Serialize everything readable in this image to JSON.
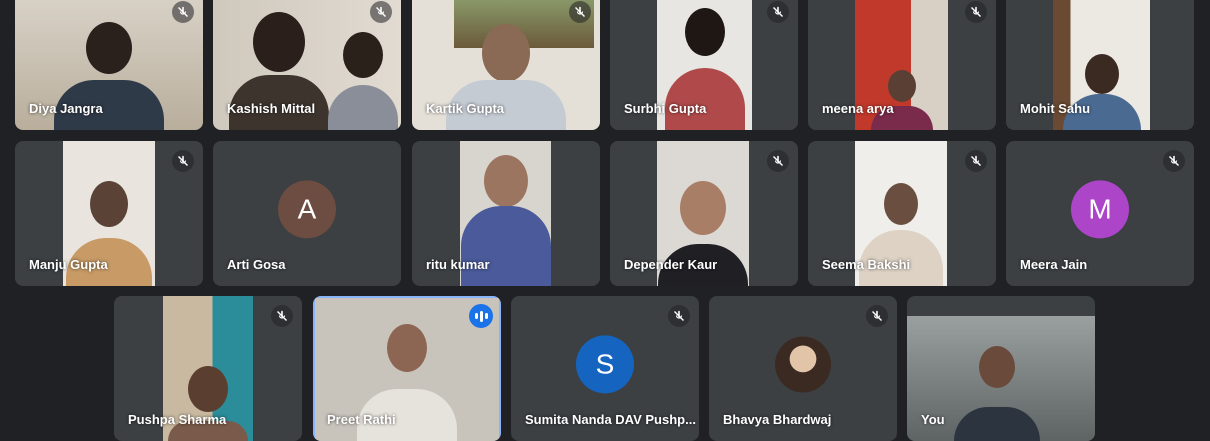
{
  "participants": {
    "diya": "Diya Jangra",
    "kashish": "Kashish Mittal",
    "kartik": "Kartik Gupta",
    "surbhi": "Surbhi Gupta",
    "meena": "meena arya",
    "mohit": "Mohit Sahu",
    "manju": "Manju Gupta",
    "arti": "Arti Gosa",
    "ritu": "ritu kumar",
    "depender": "Depender Kaur",
    "seema": "Seema Bakshi",
    "meera": "Meera Jain",
    "pushpa": "Pushpa Sharma",
    "preet": "Preet Rathi",
    "sumita": "Sumita Nanda DAV Pushp...",
    "bhavya": "Bhavya Bhardwaj",
    "you": "You"
  },
  "avatars": {
    "arti": "A",
    "meera": "M",
    "sumita": "S"
  },
  "colors": {
    "arti_avatar": "#6d4c41",
    "meera_avatar": "#ad45c9",
    "sumita_avatar": "#1565c0",
    "speaking_accent": "#1a73e8"
  },
  "icons": {
    "muted": "mic-off-icon",
    "speaking": "audio-level-icon"
  }
}
